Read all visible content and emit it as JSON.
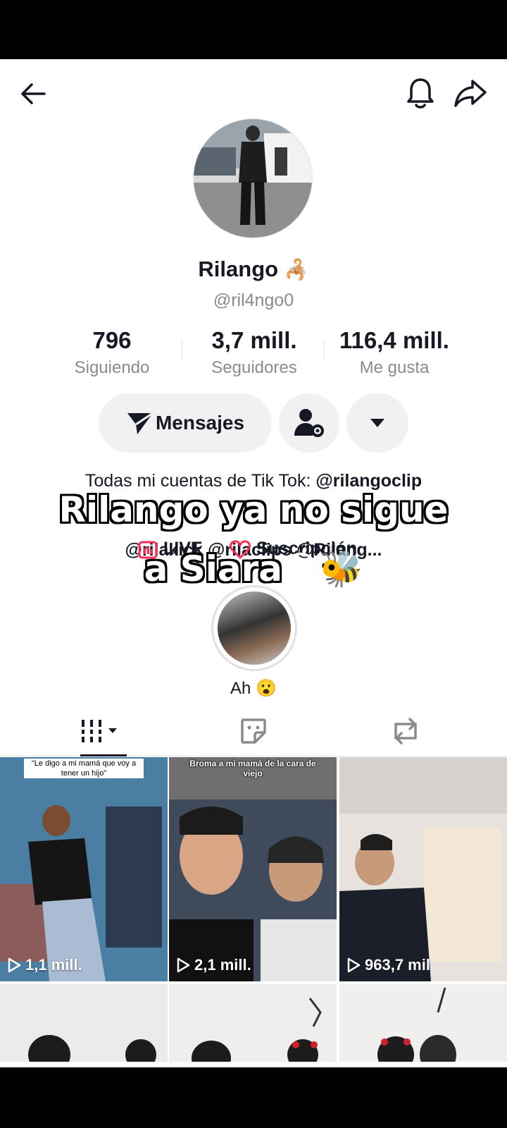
{
  "header": {
    "back_icon": "arrow-left-icon",
    "bell_icon": "bell-icon",
    "share_icon": "share-arrow-icon"
  },
  "profile": {
    "name": "Rilango",
    "name_emoji": "🦂",
    "handle": "@ril4ngo0",
    "stats": [
      {
        "value": "796",
        "label": "Siguiendo"
      },
      {
        "value": "3,7 mill.",
        "label": "Seguidores"
      },
      {
        "value": "116,4 mill.",
        "label": "Me gusta"
      }
    ]
  },
  "actions": {
    "messages_label": "Mensajes",
    "send_icon": "send-icon",
    "user_settings_icon": "user-gear-icon",
    "dropdown_icon": "caret-down-icon"
  },
  "bio": {
    "line1_prefix": "Todas mi cuentas de Tik Tok: ",
    "line1_link": "@rilangoclip",
    "line2": "@rilakick @rilaclips @Rilang...",
    "live_label": "LIVE",
    "subscription_label": "Suscripción"
  },
  "overlay": {
    "line1": "Rilango ya no sigue",
    "line2": "a Siara",
    "emojis": "😫🐝"
  },
  "highlight": {
    "label": "Ah 😮"
  },
  "tabs": {
    "videos_icon": "grid-bars-icon",
    "liked_icon": "sticker-icon",
    "repost_icon": "repost-icon"
  },
  "videos": [
    {
      "views": "1,1 mill.",
      "caption": "\"Le digo a mi mamá que voy a tener un hijo\""
    },
    {
      "views": "2,1 mill.",
      "caption": "Broma a mi mamá de la cara de viejo"
    },
    {
      "views": "963,7 mil",
      "caption": ""
    }
  ],
  "colors": {
    "accent_red": "#fe2c55",
    "text_primary": "#161823",
    "text_secondary": "#8a8b91",
    "button_bg": "#f1f1f2"
  }
}
